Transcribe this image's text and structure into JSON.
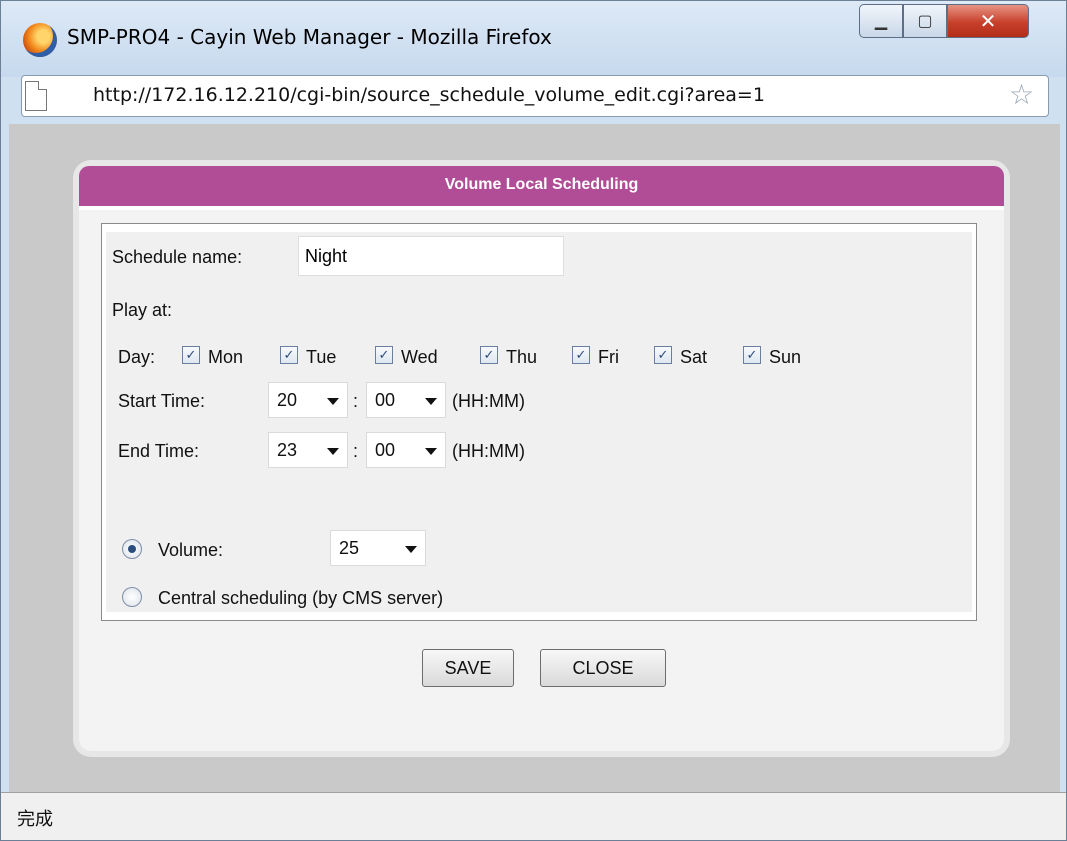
{
  "window": {
    "title": "SMP-PRO4 - Cayin Web Manager - Mozilla Firefox",
    "url": "http://172.16.12.210/cgi-bin/source_schedule_volume_edit.cgi?area=1",
    "status": "完成"
  },
  "dialog": {
    "header": "Volume Local Scheduling",
    "schedule_name_label": "Schedule name:",
    "schedule_name_value": "Night",
    "play_at_label": "Play at:",
    "day_label": "Day:",
    "days": [
      {
        "label": "Mon",
        "checked": true
      },
      {
        "label": "Tue",
        "checked": true
      },
      {
        "label": "Wed",
        "checked": true
      },
      {
        "label": "Thu",
        "checked": true
      },
      {
        "label": "Fri",
        "checked": true
      },
      {
        "label": "Sat",
        "checked": true
      },
      {
        "label": "Sun",
        "checked": true
      }
    ],
    "start_time_label": "Start Time:",
    "start_hour": "20",
    "start_minute": "00",
    "end_time_label": "End Time:",
    "end_hour": "23",
    "end_minute": "00",
    "time_sep": ":",
    "time_format": "(HH:MM)",
    "volume_label": "Volume:",
    "volume_value": "25",
    "volume_selected": true,
    "central_label": "Central scheduling (by CMS server)",
    "central_selected": false,
    "save_label": "SAVE",
    "close_label": "CLOSE"
  },
  "colors": {
    "header": "#b04d96",
    "content_bg": "#c9c9c9"
  }
}
